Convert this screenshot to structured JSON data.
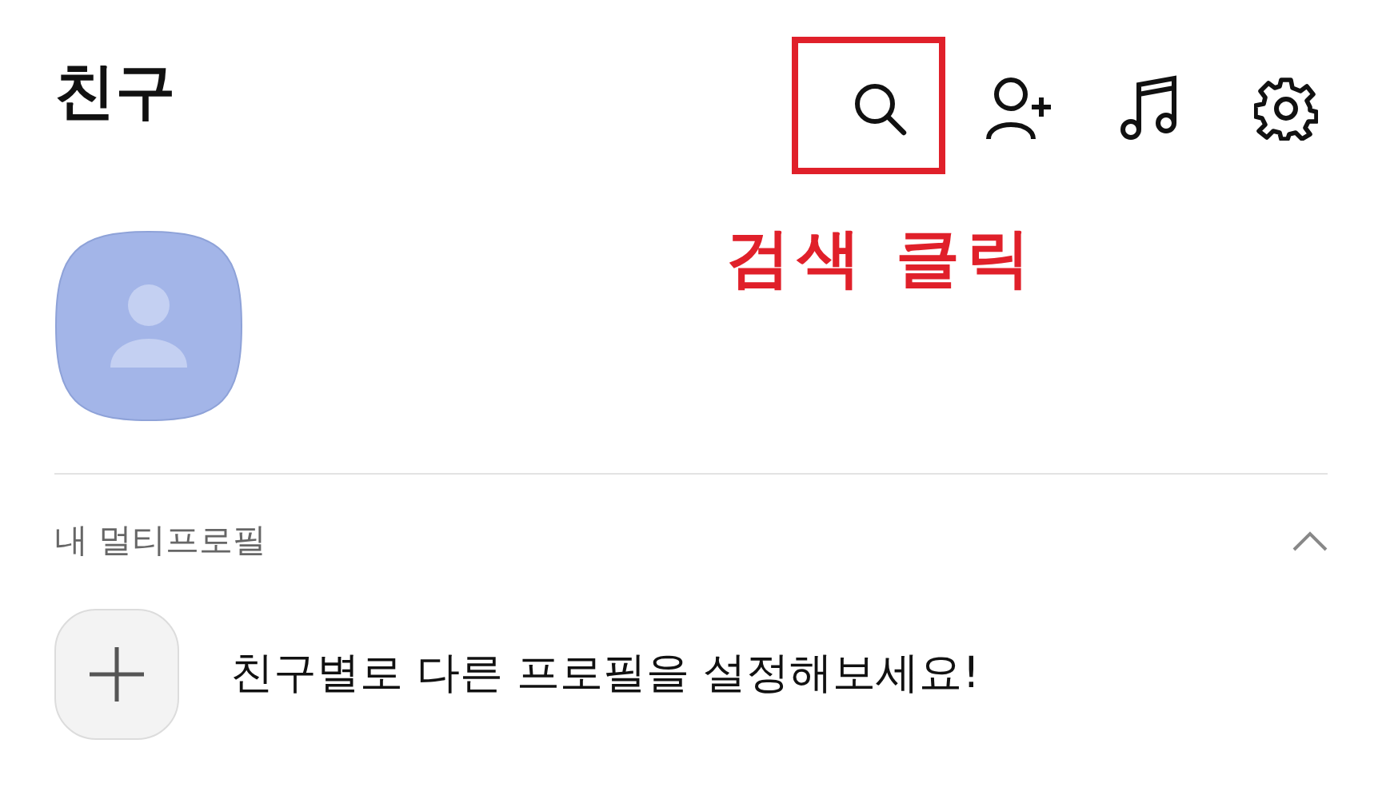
{
  "header": {
    "title": "친구"
  },
  "annotation": {
    "text": "검색 클릭"
  },
  "multi_profile": {
    "title": "내 멀티프로필",
    "expanded": true,
    "prompt": "친구별로 다른 프로필을 설정해보세요!"
  }
}
